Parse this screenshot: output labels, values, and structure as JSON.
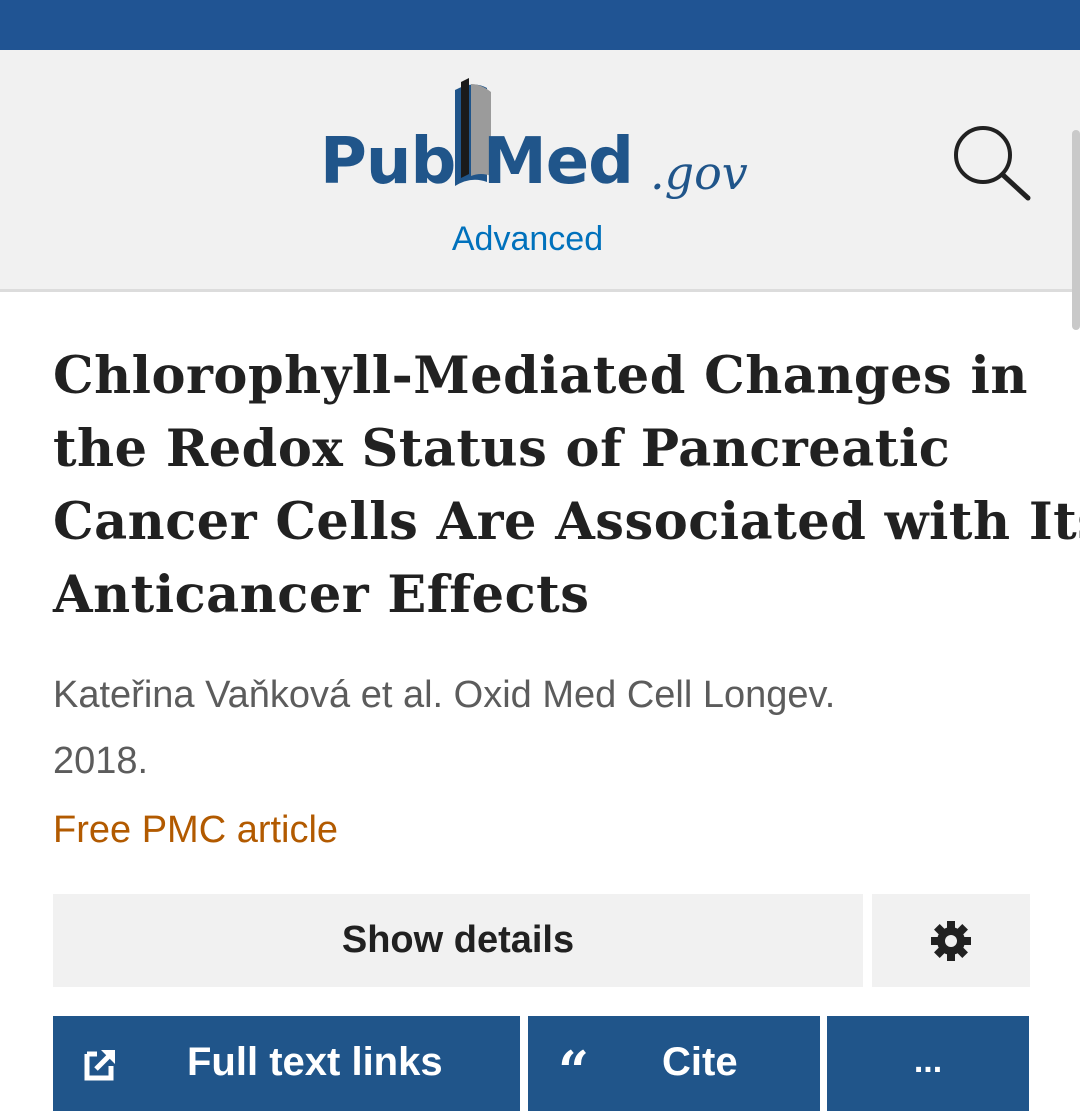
{
  "header": {
    "logo_pub": "Pub",
    "logo_med": "Med",
    "logo_gov": ".gov",
    "advanced_link": "Advanced",
    "search_icon": "search-icon"
  },
  "article": {
    "title_lines": [
      "Chlorophyll-Mediated Changes in",
      "the Redox Status of Pancreatic",
      "Cancer Cells Are Associated with Its",
      "Anticancer Effects"
    ],
    "citation_lines": [
      "Kateřina Vaňková et al. Oxid Med Cell Longev.",
      "2018."
    ],
    "free_article_link": "Free PMC article"
  },
  "actions": {
    "show_details": "Show details",
    "settings_icon": "gear-icon",
    "full_text_links": "Full text links",
    "full_text_icon": "external-link-icon",
    "cite": "Cite",
    "cite_icon": "“",
    "more": "..."
  },
  "colors": {
    "brand_blue": "#20558a",
    "link_blue": "#0071bc",
    "free_link_orange": "#b25a00",
    "title_text": "#212121",
    "header_bg": "#f1f1f1"
  }
}
